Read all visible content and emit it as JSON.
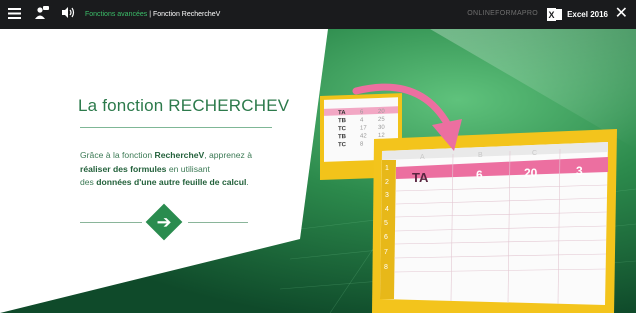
{
  "topbar": {
    "breadcrumb_section": "Fonctions avancées",
    "breadcrumb_separator": " | ",
    "breadcrumb_page": "Fonction RechercheV",
    "brand": "ONLINEFORMAPRO",
    "app_label": "Excel 2016"
  },
  "slide": {
    "title": "La fonction RECHERCHEV",
    "desc_1": "Grâce à la fonction ",
    "desc_bold_1": "RechercheV",
    "desc_2": ", apprenez à",
    "desc_bold_2": "réaliser des formules",
    "desc_3": " en utilisant",
    "desc_4": "des ",
    "desc_bold_3": "données d'une autre feuille de calcul",
    "desc_5": "."
  },
  "small_sheet": {
    "rows": [
      [
        "TA",
        "6",
        "20"
      ],
      [
        "TB",
        "4",
        "25"
      ],
      [
        "TC",
        "17",
        "30"
      ],
      [
        "TB",
        "42",
        "12"
      ],
      [
        "TC",
        "8",
        "7"
      ]
    ]
  },
  "big_sheet": {
    "col_headers": [
      "A",
      "B",
      "C"
    ],
    "row_numbers": [
      "1",
      "2",
      "3",
      "4",
      "5",
      "6",
      "7",
      "8"
    ],
    "highlight_row": [
      "TA",
      "6",
      "20",
      "3"
    ]
  },
  "colors": {
    "accent_green": "#2a8c4f",
    "highlight_pink": "#ec6fa0",
    "sheet_yellow": "#f2c31a"
  }
}
